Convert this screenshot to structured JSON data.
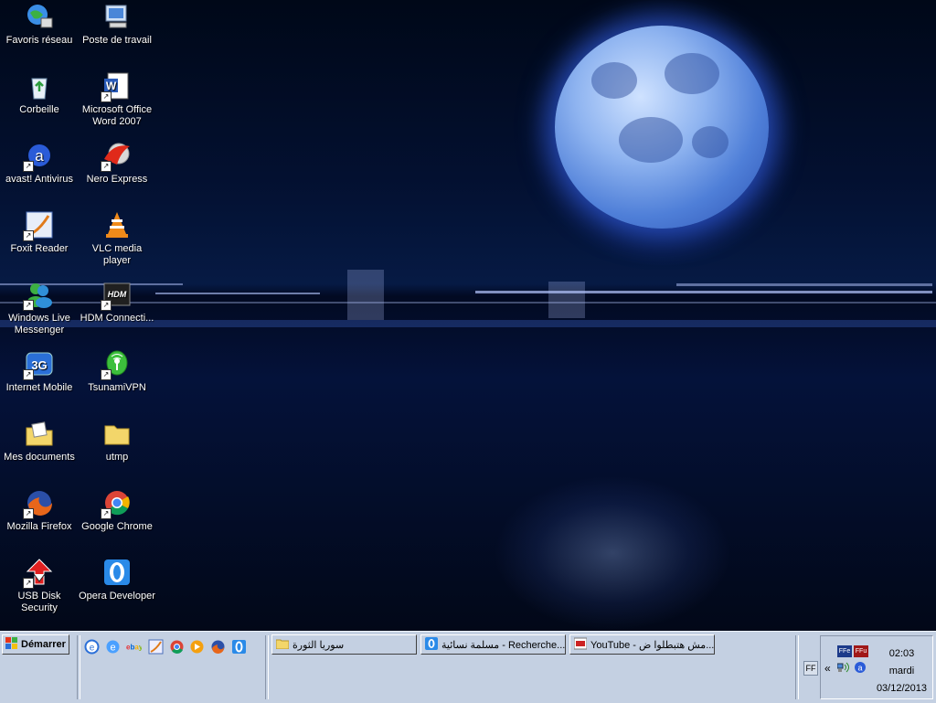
{
  "desktop_icons": [
    {
      "label": "Favoris réseau",
      "icon": "network-favorites-icon"
    },
    {
      "label": "Poste de travail",
      "icon": "my-computer-icon"
    },
    {
      "label": "Corbeille",
      "icon": "recycle-bin-icon"
    },
    {
      "label": "Microsoft Office Word 2007",
      "icon": "word-icon"
    },
    {
      "label": "avast! Antivirus",
      "icon": "avast-icon"
    },
    {
      "label": "Nero Express",
      "icon": "nero-icon"
    },
    {
      "label": "Foxit Reader",
      "icon": "foxit-icon"
    },
    {
      "label": "VLC media player",
      "icon": "vlc-icon"
    },
    {
      "label": "Windows Live Messenger",
      "icon": "messenger-icon"
    },
    {
      "label": "HDM Connecti...",
      "icon": "hdm-icon"
    },
    {
      "label": "Internet Mobile",
      "icon": "internet-mobile-3g-icon"
    },
    {
      "label": "TsunamiVPN",
      "icon": "tsunamivpn-icon"
    },
    {
      "label": "Mes documents",
      "icon": "my-documents-icon"
    },
    {
      "label": "utmp",
      "icon": "folder-icon"
    },
    {
      "label": "Mozilla Firefox",
      "icon": "firefox-icon"
    },
    {
      "label": "Google Chrome",
      "icon": "chrome-icon"
    },
    {
      "label": "USB Disk Security",
      "icon": "usb-disk-security-icon"
    },
    {
      "label": "Opera Developer",
      "icon": "opera-icon"
    }
  ],
  "taskbar": {
    "start_label": "Démarrer",
    "quick_launch": [
      "ie-icon",
      "ie-icon",
      "ebay-icon",
      "foxit-icon",
      "chrome-icon",
      "media-player-icon",
      "firefox-icon",
      "opera-icon"
    ],
    "windows": [
      {
        "title": "سوريا الثورة",
        "icon": "folder-icon",
        "active": false
      },
      {
        "title": "مسلمة نسائية - Recherche...",
        "icon": "opera-icon",
        "active": false
      },
      {
        "title": "YouTube - مش هتبطلوا ض...",
        "icon": "youtube-icon",
        "active": false
      }
    ],
    "language": "FF",
    "tray_expand": "«",
    "tray_icons": [
      "ff-tray-icon",
      "ffu-tray-icon",
      "network-tray-icon",
      "avast-tray-icon"
    ],
    "tray_labels": {
      "ff": "FFe",
      "ffu": "FFu"
    },
    "clock": {
      "time": "02:03",
      "day": "mardi",
      "date": "03/12/2013"
    }
  }
}
